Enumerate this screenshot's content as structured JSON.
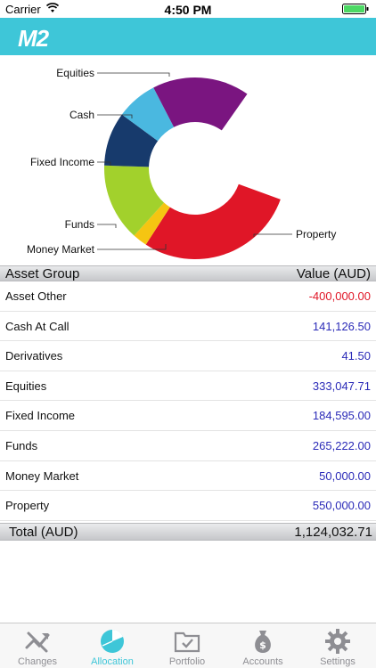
{
  "status": {
    "carrier": "Carrier",
    "time": "4:50 PM"
  },
  "header": {
    "logo": "M2"
  },
  "chart_data": {
    "type": "pie",
    "categories": [
      "Equities",
      "Cash",
      "Fixed Income",
      "Funds",
      "Money Market",
      "Property"
    ],
    "values": [
      333047.71,
      141126.5,
      184595.0,
      265222.0,
      50000.0,
      550000.0
    ],
    "colors": [
      "#7a1580",
      "#4ab8e0",
      "#173a6c",
      "#a2d12c",
      "#f5c512",
      "#e01627"
    ]
  },
  "table": {
    "col_name": "Asset Group",
    "col_value": "Value (AUD)",
    "rows": [
      {
        "name": "Asset Other",
        "value": "-400,000.00",
        "color": "#e01627"
      },
      {
        "name": "Cash At Call",
        "value": "141,126.50",
        "color": "#2b2bb8"
      },
      {
        "name": "Derivatives",
        "value": "41.50",
        "color": "#2b2bb8"
      },
      {
        "name": "Equities",
        "value": "333,047.71",
        "color": "#2b2bb8"
      },
      {
        "name": "Fixed Income",
        "value": "184,595.00",
        "color": "#2b2bb8"
      },
      {
        "name": "Funds",
        "value": "265,222.00",
        "color": "#2b2bb8"
      },
      {
        "name": "Money Market",
        "value": "50,000.00",
        "color": "#2b2bb8"
      },
      {
        "name": "Property",
        "value": "550,000.00",
        "color": "#2b2bb8"
      }
    ],
    "total_label": "Total (AUD)",
    "total_value": "1,124,032.71"
  },
  "tabs": [
    {
      "label": "Changes",
      "icon": "changes-icon"
    },
    {
      "label": "Allocation",
      "icon": "allocation-icon",
      "active": true
    },
    {
      "label": "Portfolio",
      "icon": "portfolio-icon"
    },
    {
      "label": "Accounts",
      "icon": "accounts-icon"
    },
    {
      "label": "Settings",
      "icon": "gear-icon"
    }
  ]
}
